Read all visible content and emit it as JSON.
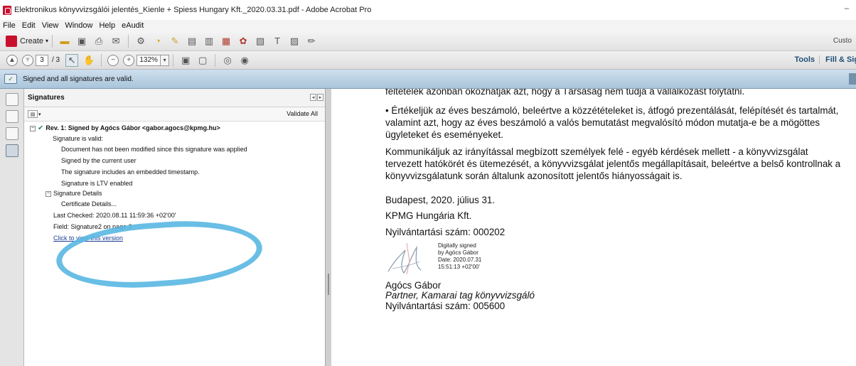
{
  "window": {
    "title": "Elektronikus könyvvizsgálói jelentés_Kienle + Spiess Hungary Kft._2020.03.31.pdf - Adobe Acrobat Pro",
    "minimize": "–"
  },
  "menu": [
    "File",
    "Edit",
    "View",
    "Window",
    "Help",
    "eAudit"
  ],
  "toolbar": {
    "create_label": "Create",
    "right_cut_label": "Custo",
    "page_current": "3",
    "page_total": "/ 3",
    "zoom": "132%",
    "tools_label": "Tools",
    "fill_sign_label": "Fill & Sig"
  },
  "signature_bar": {
    "text": "Signed and all signatures are valid."
  },
  "signatures_panel": {
    "title": "Signatures",
    "validate_all": "Validate All",
    "revision": "Rev. 1: Signed by Agócs Gábor <gabor.agocs@kpmg.hu>",
    "lines": [
      "Signature is valid:",
      "Document has not been modified since this signature was applied",
      "Signed by the current user",
      "The signature includes an embedded timestamp.",
      "Signature is LTV enabled"
    ],
    "details_label": "Signature Details",
    "certificate": "Certificate Details...",
    "last_checked": "Last Checked: 2020.08.11 11:59:36 +02'00'",
    "field": "Field: Signature2 on page 3",
    "view_version": "Click to view this version"
  },
  "document": {
    "line0": "feltételek azonban okozhatják azt, hogy a Társaság nem tudja a vállalkozást folytatni.",
    "line1": "• Értékeljük az éves beszámoló, beleértve a közzétételeket is, átfogó prezentálását, felépítését és tartalmát,",
    "line2": "valamint azt, hogy az éves beszámoló a valós bemutatást megvalósító módon mutatja-e be a mögöttes",
    "line3": "ügyleteket és eseményeket.",
    "line4": "Kommunikáljuk az irányítással megbízott személyek felé - egyéb kérdések mellett - a könyvvizsgálat",
    "line5": "tervezett hatókörét és ütemezését, a könyvvizsgálat jelentős megállapításait, beleértve a belső kontrollnak a",
    "line6": "könyvvizsgálatunk során általunk azonosított jelentős hiányosságait is.",
    "city_date": "Budapest, 2020. július 31.",
    "company": "KPMG Hungária Kft.",
    "reg_no": "Nyilvántartási szám: 000202",
    "stamp_lines": [
      "Digitally signed",
      "by Agócs Gábor",
      "Date: 2020.07.31",
      "15:51:13 +02'00'"
    ],
    "signer": "Agócs Gábor",
    "role": "Partner, Kamarai tag könyvvizsgáló",
    "signer_reg": "Nyilvántartási szám: 005600"
  }
}
